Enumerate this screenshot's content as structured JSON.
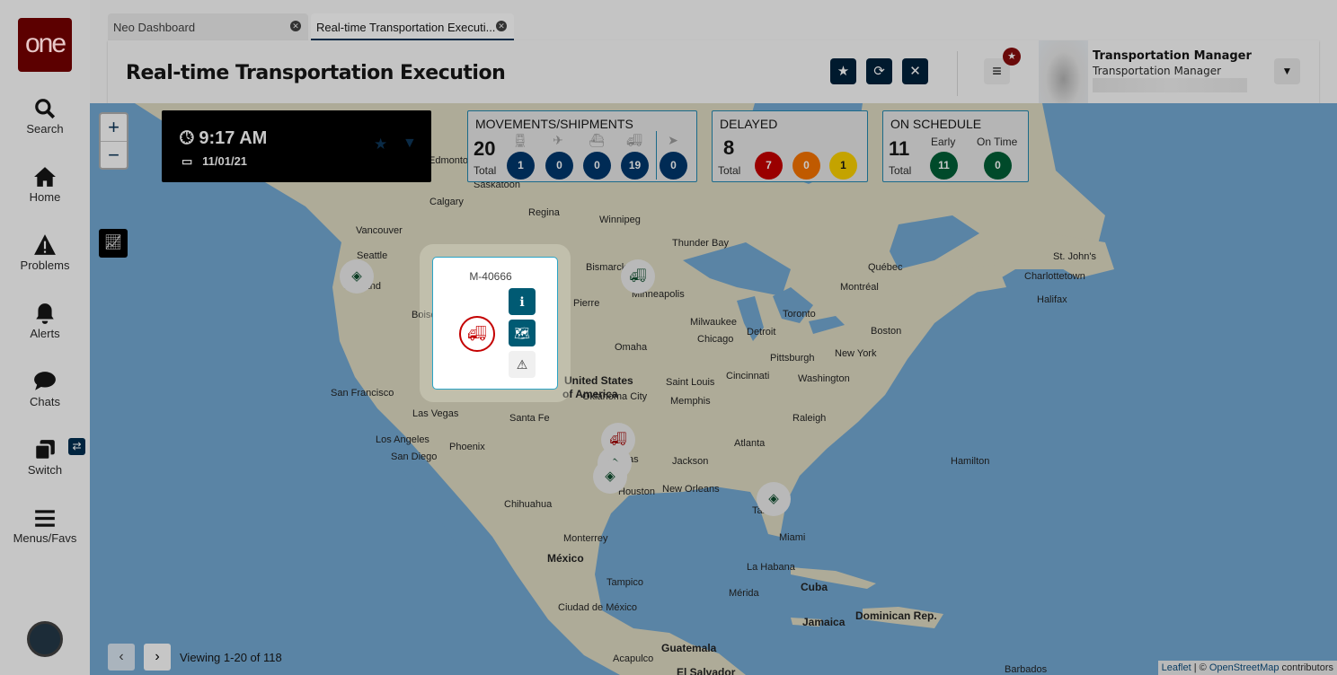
{
  "sidebar": {
    "logo": "one",
    "items": [
      {
        "label": "Search",
        "icon": "search-icon"
      },
      {
        "label": "Home",
        "icon": "home-icon"
      },
      {
        "label": "Problems",
        "icon": "warning-icon"
      },
      {
        "label": "Alerts",
        "icon": "bell-icon"
      },
      {
        "label": "Chats",
        "icon": "chat-icon"
      },
      {
        "label": "Switch",
        "icon": "switch-icon"
      },
      {
        "label": "Menus/Favs",
        "icon": "menu-icon"
      }
    ]
  },
  "tabs": [
    {
      "label": "Neo Dashboard"
    },
    {
      "label": "Real-time Transportation Executi..."
    }
  ],
  "header": {
    "title": "Real-time Transportation Execution",
    "user_name": "Transportation Manager",
    "user_role": "Transportation Manager"
  },
  "clock": {
    "time": "9:17 AM",
    "date": "11/01/21"
  },
  "movements": {
    "title": "MOVEMENTS/SHIPMENTS",
    "total": "20",
    "total_label": "Total",
    "counts": [
      {
        "mode": "rail",
        "icon": "train-icon",
        "value": "1"
      },
      {
        "mode": "air",
        "icon": "plane-icon",
        "value": "0"
      },
      {
        "mode": "ocean",
        "icon": "ship-icon",
        "value": "0"
      },
      {
        "mode": "truck",
        "icon": "truck-icon",
        "value": "19"
      },
      {
        "mode": "other",
        "icon": "location-arrow-icon",
        "value": "0"
      }
    ]
  },
  "delayed": {
    "title": "DELAYED",
    "total": "8",
    "total_label": "Total",
    "counts": [
      "7",
      "0",
      "1"
    ],
    "colors": [
      "#9a0000",
      "#c05a00",
      "#c4a300"
    ]
  },
  "on_schedule": {
    "title": "ON SCHEDULE",
    "total": "11",
    "total_label": "Total",
    "early_label": "Early",
    "early": "11",
    "ontime_label": "On Time",
    "ontime": "0"
  },
  "popup": {
    "id": "M-40666"
  },
  "pager": {
    "text": "Viewing 1-20 of 118"
  },
  "attribution": {
    "leaflet": "Leaflet",
    "sep": " | © ",
    "osm": "OpenStreetMap",
    "suffix": " contributors"
  },
  "cities": [
    "Edmonton",
    "Saskatoon",
    "Calgary",
    "Regina",
    "Winnipeg",
    "Vancouver",
    "Seattle",
    "Portland",
    "Thunder Bay",
    "Bismarck",
    "Minneapolis",
    "Québec",
    "Montréal",
    "St. John's",
    "Charlottetown",
    "Halifax",
    "Pierre",
    "Boise",
    "Toronto",
    "Milwaukee",
    "Chicago",
    "Detroit",
    "Boston",
    "Omaha",
    "Pittsburgh",
    "New York",
    "San Francisco",
    "United States",
    "of America",
    "Cincinnati",
    "Saint Louis",
    "Washington",
    "Las Vegas",
    "Santa Fe",
    "Oklahoma City",
    "Memphis",
    "Raleigh",
    "Los Angeles",
    "San Diego",
    "Phoenix",
    "Atlanta",
    "Hamilton",
    "Dallas",
    "Jackson",
    "Houston",
    "New Orleans",
    "Tampa",
    "Chihuahua",
    "Miami",
    "Monterrey",
    "México",
    "La Habana",
    "Cuba",
    "Tampico",
    "Mérida",
    "Jamaica",
    "Dominican Rep.",
    "Ciudad de México",
    "Guatemala",
    "Acapulco",
    "El Salvador",
    "Barbados"
  ]
}
